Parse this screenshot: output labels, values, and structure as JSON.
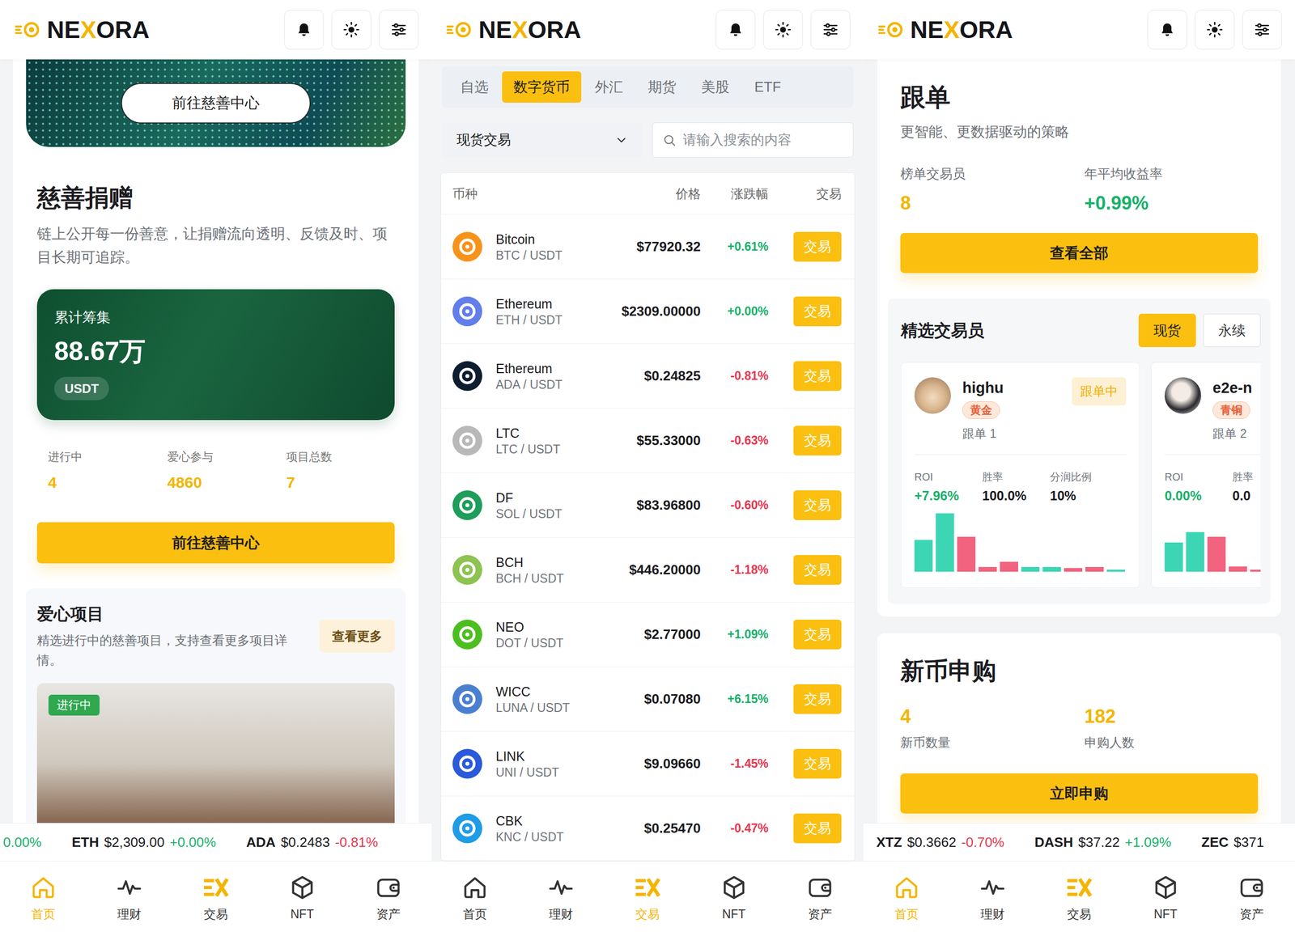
{
  "screen_charity": {
    "header": {
      "logo": [
        {
          "text": "NE",
          "accent": false
        },
        {
          "text": "X",
          "accent": true
        },
        {
          "text": "ORA",
          "accent": false
        }
      ]
    },
    "banner": {
      "button": "前往慈善中心"
    },
    "charity": {
      "title": "慈善捐赠",
      "description": "链上公开每一份善意，让捐赠流向透明、反馈及时、项目长期可追踪。",
      "total": {
        "label": "累计筹集",
        "value": "88.67万",
        "unit": "USDT"
      },
      "stats": [
        {
          "label": "进行中",
          "value": "4"
        },
        {
          "label": "爱心参与",
          "value": "4860"
        },
        {
          "label": "项目总数",
          "value": "7"
        }
      ],
      "button": "前往慈善中心"
    },
    "projects": {
      "title": "爱心项目",
      "description": "精选进行中的慈善项目，支持查看更多项目详情。",
      "more_button": "查看更多",
      "items": [
        {
          "status": "进行中"
        }
      ]
    },
    "ticker": [
      {
        "change": "0.00%",
        "up": true
      },
      {
        "symbol": "ETH",
        "price": "$2,309.00",
        "change": "+0.00%",
        "up": true
      },
      {
        "symbol": "ADA",
        "price": "$0.2483",
        "change": "-0.81%",
        "up": false
      }
    ],
    "nav": [
      {
        "label": "首页",
        "selected": true
      },
      {
        "label": "理财",
        "selected": false
      },
      {
        "label": "交易",
        "selected": false
      },
      {
        "label": "NFT",
        "selected": false
      },
      {
        "label": "资产",
        "selected": false
      }
    ]
  },
  "screen_markets": {
    "header": {
      "logo": [
        {
          "text": "NE",
          "accent": false
        },
        {
          "text": "X",
          "accent": true
        },
        {
          "text": "ORA",
          "accent": false
        }
      ]
    },
    "tabs": [
      {
        "label": "自选",
        "selected": false
      },
      {
        "label": "数字货币",
        "selected": true
      },
      {
        "label": "外汇",
        "selected": false
      },
      {
        "label": "期货",
        "selected": false
      },
      {
        "label": "美股",
        "selected": false
      },
      {
        "label": "ETF",
        "selected": false
      }
    ],
    "market_select": {
      "value": "现货交易"
    },
    "search": {
      "placeholder": "请输入搜索的内容"
    },
    "table": {
      "columns": [
        "币种",
        "价格",
        "涨跌幅",
        "交易"
      ],
      "rows": [
        {
          "name": "Bitcoin",
          "pair": "BTC / USDT",
          "price": "$77920.32",
          "change": "+0.61%",
          "up": true,
          "action": "交易",
          "color": "#f7931a"
        },
        {
          "name": "Ethereum",
          "pair": "ETH / USDT",
          "price": "$2309.00000",
          "change": "+0.00%",
          "up": true,
          "action": "交易",
          "color": "#627eea"
        },
        {
          "name": "Ethereum",
          "pair": "ADA / USDT",
          "price": "$0.24825",
          "change": "-0.81%",
          "up": false,
          "action": "交易",
          "color": "#0d1e30"
        },
        {
          "name": "LTC",
          "pair": "LTC / USDT",
          "price": "$55.33000",
          "change": "-0.63%",
          "up": false,
          "action": "交易",
          "color": "#b8b8b8"
        },
        {
          "name": "DF",
          "pair": "SOL / USDT",
          "price": "$83.96800",
          "change": "-0.60%",
          "up": false,
          "action": "交易",
          "color": "#1e9e5a"
        },
        {
          "name": "BCH",
          "pair": "BCH / USDT",
          "price": "$446.20000",
          "change": "-1.18%",
          "up": false,
          "action": "交易",
          "color": "#8dc351"
        },
        {
          "name": "NEO",
          "pair": "DOT / USDT",
          "price": "$2.77000",
          "change": "+1.09%",
          "up": true,
          "action": "交易",
          "color": "#4cbf1f"
        },
        {
          "name": "WICC",
          "pair": "LUNA / USDT",
          "price": "$0.07080",
          "change": "+6.15%",
          "up": true,
          "action": "交易",
          "color": "#4a7fd0"
        },
        {
          "name": "LINK",
          "pair": "UNI / USDT",
          "price": "$9.09660",
          "change": "-1.45%",
          "up": false,
          "action": "交易",
          "color": "#2a5ada"
        },
        {
          "name": "CBK",
          "pair": "KNC / USDT",
          "price": "$0.25470",
          "change": "-0.47%",
          "up": false,
          "action": "交易",
          "color": "#1f9ce6"
        }
      ]
    },
    "nav": [
      {
        "label": "首页",
        "selected": false
      },
      {
        "label": "理财",
        "selected": false
      },
      {
        "label": "交易",
        "selected": true
      },
      {
        "label": "NFT",
        "selected": false
      },
      {
        "label": "资产",
        "selected": false
      }
    ]
  },
  "screen_copy": {
    "header": {
      "logo": [
        {
          "text": "NE",
          "accent": false
        },
        {
          "text": "X",
          "accent": true
        },
        {
          "text": "ORA",
          "accent": false
        }
      ]
    },
    "copy_trading": {
      "title": "跟单",
      "subtitle": "更智能、更数据驱动的策略",
      "stats": [
        {
          "label": "榜单交易员",
          "value": "8",
          "kind": "count"
        },
        {
          "label": "年平均收益率",
          "value": "+0.99%",
          "kind": "gain"
        }
      ],
      "button": "查看全部"
    },
    "traders": {
      "title": "精选交易员",
      "filters": [
        {
          "label": "现货",
          "selected": true
        },
        {
          "label": "永续",
          "selected": false
        }
      ],
      "cards": [
        {
          "name": "highu",
          "tier": "黄金",
          "status": "跟单中",
          "followers": "跟单 1",
          "metrics": [
            {
              "label": "ROI",
              "value": "+7.96%",
              "kind": "gain"
            },
            {
              "label": "胜率",
              "value": "100.0%",
              "kind": "plain"
            },
            {
              "label": "分润比例",
              "value": "10%",
              "kind": "plain"
            }
          ],
          "bars": [
            {
              "value": 41,
              "up": true
            },
            {
              "value": 75,
              "up": true
            },
            {
              "value": 45,
              "up": false
            },
            {
              "value": 6,
              "up": false
            },
            {
              "value": 13,
              "up": false
            },
            {
              "value": 6,
              "up": true
            },
            {
              "value": 6,
              "up": true
            },
            {
              "value": 5,
              "up": false
            },
            {
              "value": 6,
              "up": false
            },
            {
              "value": 3,
              "up": true
            }
          ]
        },
        {
          "name": "e2e-n",
          "tier": "青铜",
          "followers": "跟单 2",
          "metrics": [
            {
              "label": "ROI",
              "value": "0.00%",
              "kind": "gain"
            },
            {
              "label": "胜率",
              "value": "0.0",
              "kind": "plain"
            }
          ],
          "bars": [
            {
              "value": 38,
              "up": true
            },
            {
              "value": 51,
              "up": true
            },
            {
              "value": 45,
              "up": false
            },
            {
              "value": 7,
              "up": false
            },
            {
              "value": 3,
              "up": false
            }
          ]
        }
      ]
    },
    "ipo": {
      "title": "新币申购",
      "stats": [
        {
          "value": "4",
          "label": "新币数量"
        },
        {
          "value": "182",
          "label": "申购人数"
        }
      ],
      "button": "立即申购"
    },
    "ticker": [
      {
        "symbol": "XTZ",
        "price": "$0.3662",
        "change": "-0.70%",
        "up": false
      },
      {
        "symbol": "DASH",
        "price": "$37.22",
        "change": "+1.09%",
        "up": true
      },
      {
        "symbol": "ZEC",
        "price": "$371"
      }
    ],
    "nav": [
      {
        "label": "首页",
        "selected": true
      },
      {
        "label": "理财",
        "selected": false
      },
      {
        "label": "交易",
        "selected": false
      },
      {
        "label": "NFT",
        "selected": false
      },
      {
        "label": "资产",
        "selected": false
      }
    ]
  }
}
